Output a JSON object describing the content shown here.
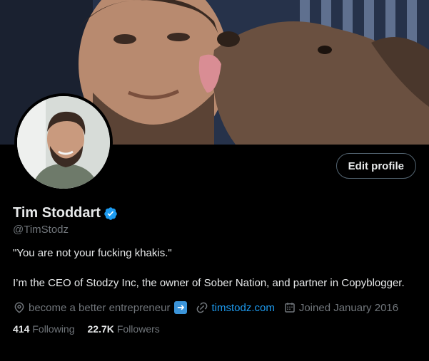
{
  "profile": {
    "name": "Tim Stoddart",
    "handle": "@TimStodz",
    "edit_label": "Edit profile",
    "bio_line1": "\"You are not your fucking khakis.\"",
    "bio_line2": "I’m the CEO of Stodzy Inc, the owner of Sober Nation, and partner in Copyblogger.",
    "location": "become a better entrepreneur",
    "website": "timstodz.com",
    "joined": "Joined January 2016",
    "following_count": "414",
    "following_label": "Following",
    "followers_count": "22.7K",
    "followers_label": "Followers"
  },
  "icons": {
    "verified": "verified-badge-icon",
    "location": "location-pin-icon",
    "link": "link-icon",
    "calendar": "calendar-icon",
    "arrow": "right-arrow-emoji-icon"
  },
  "colors": {
    "background": "#000000",
    "text": "#e7e9ea",
    "secondary_text": "#71767b",
    "link": "#1d9bf0",
    "verified": "#1d9bf0"
  }
}
